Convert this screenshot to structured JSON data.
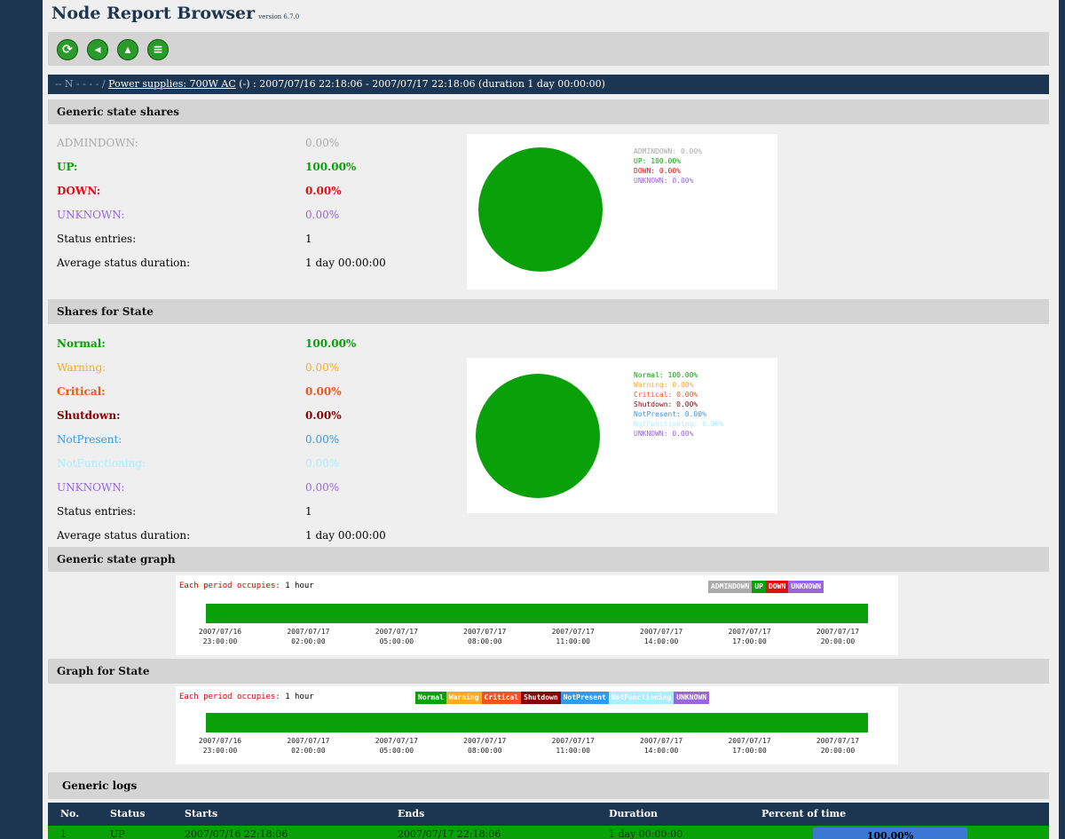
{
  "app": {
    "title": "Node Report Browser",
    "version": "version 6.7.0"
  },
  "toolbar": {
    "buttons": [
      {
        "name": "refresh-icon",
        "glyph": "⟳"
      },
      {
        "name": "back-icon",
        "glyph": "◂"
      },
      {
        "name": "up-icon",
        "glyph": "▴"
      },
      {
        "name": "print-icon",
        "glyph": "≡"
      }
    ]
  },
  "breadcrumb": {
    "path": "‐‐ N ‐ ‐ ‐ ‐ /",
    "link": "Power supplies: 700W AC",
    "rest": "(-) : 2007/07/16 22:18:06 - 2007/07/17 22:18:06 (duration 1 day 00:00:00)"
  },
  "generic": {
    "header": "Generic state shares",
    "states": [
      {
        "label": "ADMINDOWN:",
        "value": "0.00%",
        "color": "#aaaaaa",
        "bold": false
      },
      {
        "label": "UP:",
        "value": "100.00%",
        "color": "#0aa00a",
        "bold": true
      },
      {
        "label": "DOWN:",
        "value": "0.00%",
        "color": "#dd1111",
        "bold": true
      },
      {
        "label": "UNKNOWN:",
        "value": "0.00%",
        "color": "#9966dd",
        "bold": false
      }
    ],
    "status_entries_label": "Status entries:",
    "status_entries": "1",
    "avg_label": "Average status duration:",
    "avg": "1 day 00:00:00",
    "legend": [
      {
        "text": "ADMINDOWN: 0.00%",
        "color": "#aaaaaa"
      },
      {
        "text": "UP: 100.00%",
        "color": "#0aa00a"
      },
      {
        "text": "DOWN: 0.00%",
        "color": "#dd1111"
      },
      {
        "text": "UNKNOWN: 0.00%",
        "color": "#9966dd"
      }
    ]
  },
  "state": {
    "header": "Shares for State",
    "states": [
      {
        "label": "Normal:",
        "value": "100.00%",
        "color": "#0aa00a",
        "bold": true
      },
      {
        "label": "Warning:",
        "value": "0.00%",
        "color": "#ffaa22",
        "bold": false
      },
      {
        "label": "Critical:",
        "value": "0.00%",
        "color": "#ee5522",
        "bold": true
      },
      {
        "label": "Shutdown:",
        "value": "0.00%",
        "color": "#880000",
        "bold": true
      },
      {
        "label": "NotPresent:",
        "value": "0.00%",
        "color": "#3399ee",
        "bold": false
      },
      {
        "label": "NotFunctioning:",
        "value": "0.00%",
        "color": "#aaeeff",
        "bold": false
      },
      {
        "label": "UNKNOWN:",
        "value": "0.00%",
        "color": "#9966dd",
        "bold": false
      }
    ],
    "status_entries_label": "Status entries:",
    "status_entries": "1",
    "avg_label": "Average status duration:",
    "avg": "1 day 00:00:00",
    "legend": [
      {
        "text": "Normal: 100.00%",
        "color": "#0aa00a"
      },
      {
        "text": "Warning: 0.00%",
        "color": "#ffaa22"
      },
      {
        "text": "Critical: 0.00%",
        "color": "#ee5522"
      },
      {
        "text": "Shutdown: 0.00%",
        "color": "#880000"
      },
      {
        "text": "NotPresent: 0.00%",
        "color": "#3399ee"
      },
      {
        "text": "NotFunctioning: 0.00%",
        "color": "#aaeeff"
      },
      {
        "text": "UNKNOWN: 0.00%",
        "color": "#9966dd"
      }
    ]
  },
  "graph_generic": {
    "header": "Generic state graph",
    "caption": "Each period occupies:",
    "period": "1 hour",
    "legend": [
      {
        "text": "ADMINDOWN",
        "color": "#aaaaaa"
      },
      {
        "text": "UP",
        "color": "#0aa00a"
      },
      {
        "text": "DOWN",
        "color": "#dd1111"
      },
      {
        "text": "UNKNOWN",
        "color": "#9966dd"
      }
    ]
  },
  "graph_state": {
    "header": "Graph for State",
    "caption": "Each period occupies:",
    "period": "1 hour",
    "legend": [
      {
        "text": "Normal",
        "color": "#0aa00a"
      },
      {
        "text": "Warning",
        "color": "#ffaa22"
      },
      {
        "text": "Critical",
        "color": "#ee5522"
      },
      {
        "text": "Shutdown",
        "color": "#880000"
      },
      {
        "text": "NotPresent",
        "color": "#3399ee"
      },
      {
        "text": "NotFunctioning",
        "color": "#aaeeff"
      },
      {
        "text": "UNKNOWN",
        "color": "#9966dd"
      }
    ]
  },
  "time_ticks": [
    [
      "2007/07/16",
      "23:00:00"
    ],
    [
      "2007/07/17",
      "02:00:00"
    ],
    [
      "2007/07/17",
      "05:00:00"
    ],
    [
      "2007/07/17",
      "08:00:00"
    ],
    [
      "2007/07/17",
      "11:00:00"
    ],
    [
      "2007/07/17",
      "14:00:00"
    ],
    [
      "2007/07/17",
      "17:00:00"
    ],
    [
      "2007/07/17",
      "20:00:00"
    ]
  ],
  "logs": {
    "header": "Generic logs",
    "columns": [
      "No.",
      "Status",
      "Starts",
      "Ends",
      "Duration",
      "Percent of time"
    ],
    "rows": [
      {
        "no": "1",
        "status": "UP",
        "starts": "2007/07/16 22:18:06",
        "ends": "2007/07/17 22:18:06",
        "duration": "1 day 00:00:00",
        "percent": "100.00%"
      }
    ]
  },
  "colors": {
    "header_bg": "#1c3550",
    "section_bg": "#d4d4d4",
    "bar_green": "#0aa00a"
  }
}
